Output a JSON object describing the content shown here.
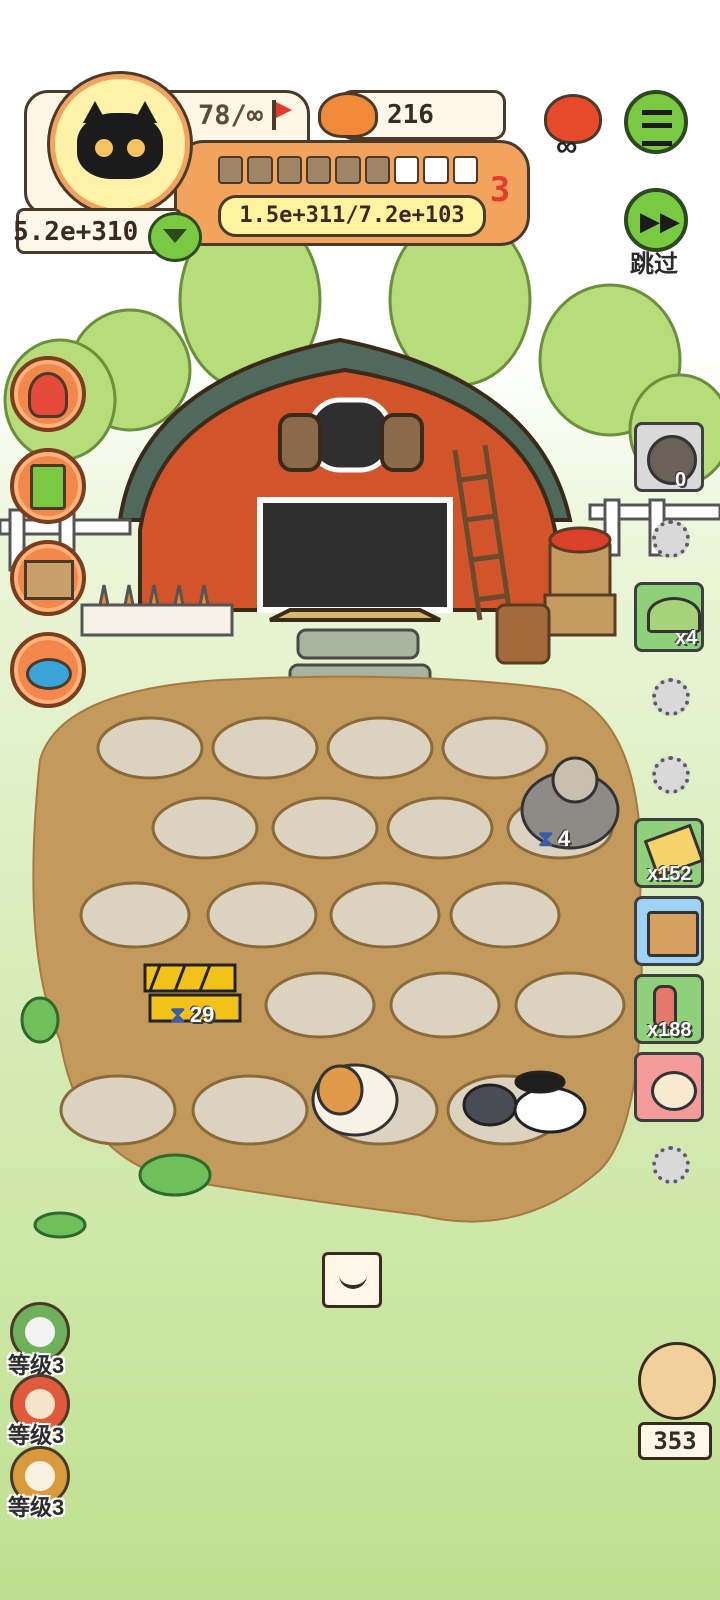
{
  "player": {
    "avatar": "black-cat-avatar",
    "energy": "78/∞",
    "coins": "5.2e+310",
    "food": "216",
    "progress_text": "1.5e+311/7.2e+103",
    "progress_segments_total": 9,
    "progress_segments_filled": 6,
    "level": "3"
  },
  "top_right": {
    "menu_icon": "menu-list-icon",
    "skip_label": "跳过",
    "event_icon": "fire-infinity-icon"
  },
  "farm": {
    "sloth_timer": "4",
    "barrier_timer": "29"
  },
  "right_items": [
    {
      "name": "rock-cookie-item",
      "count": "0"
    },
    {
      "name": "helmet-item",
      "count": "x4"
    },
    {
      "name": "ticket-item",
      "count": "x152"
    },
    {
      "name": "tv-item",
      "count": ""
    },
    {
      "name": "worm-item",
      "count": "x188"
    },
    {
      "name": "heart-cat-item",
      "count": ""
    }
  ],
  "left_levels": [
    {
      "icon": "green-creature-icon",
      "label": "等级3"
    },
    {
      "icon": "red-creature-icon",
      "label": "等级3"
    },
    {
      "icon": "mushroom-creature-icon",
      "label": "等级3"
    }
  ],
  "hamster_counter": "353",
  "colors": {
    "accent_orange": "#f2a35e",
    "menu_green": "#7ac943",
    "grass": "#cfe8a6"
  }
}
